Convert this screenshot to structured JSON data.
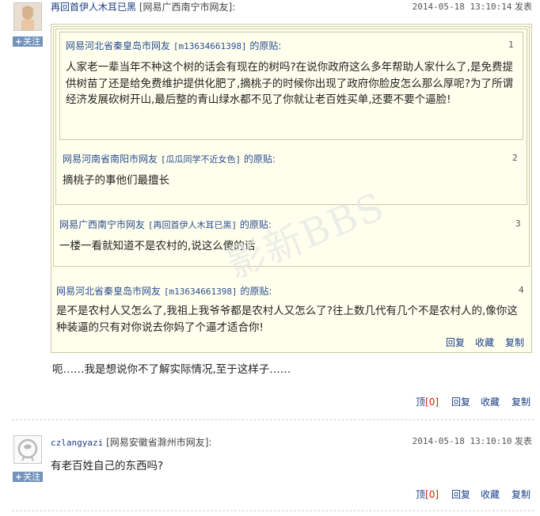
{
  "post1": {
    "author_name": "再回首伊人木耳已黑",
    "author_meta": "[网易广西南宁市网友]:",
    "timestamp": "2014-05-18 13:10:14",
    "post_label": "发表",
    "follow_label": "关注",
    "quotes": [
      {
        "num": "1",
        "header_prefix": "网易河北省秦皇岛市网友",
        "header_id": "[m13634661398]",
        "header_suffix": "的原贴:",
        "text": "人家老一辈当年不种这个树的话会有现在的树吗?在说你政府这么多年帮助人家什么了,是免费提供树苗了还是给免费维护提供化肥了,摘桃子的时候你出现了政府你脸皮怎么那么厚呢?为了所谓经济发展砍树开山,最后整的青山绿水都不见了你就让老百姓买单,还要不要个逼脸!"
      },
      {
        "num": "2",
        "header_prefix": "网易河南省南阳市网友",
        "header_id": "[瓜瓜同学不近女色]",
        "header_suffix": "的原贴:",
        "text": "摘桃子的事他们最擅长"
      },
      {
        "num": "3",
        "header_prefix": "网易广西南宁市网友",
        "header_id": "[再回首伊人木耳已黑]",
        "header_suffix": "的原贴:",
        "text": "一楼一看就知道不是农村的,说这么傻的话"
      },
      {
        "num": "4",
        "header_prefix": "网易河北省秦皇岛市网友",
        "header_id": "[m13634661398]",
        "header_suffix": "的原贴:",
        "text": "是不是农村人又怎么了,我祖上我爷爷都是农村人又怎么了?往上数几代有几个不是农村人的,像你这种装逼的只有对你说去你妈了个逼才适合你!"
      }
    ],
    "quote_actions": {
      "reply": "回复",
      "collect": "收藏",
      "copy": "复制"
    },
    "body": "呃……我是想说你不了解实际情况,至于这样子……",
    "actions": {
      "top": "顶",
      "top_count": "[0]",
      "reply": "回复",
      "collect": "收藏",
      "copy": "复制"
    }
  },
  "post2": {
    "author_name": "czlangyazi",
    "author_meta": "[网易安徽省滁州市网友]:",
    "timestamp": "2014-05-18 13:10:10",
    "post_label": "发表",
    "follow_label": "关注",
    "body": "有老百姓自己的东西吗?",
    "actions": {
      "top": "顶",
      "top_count": "[0]",
      "reply": "回复",
      "collect": "收藏",
      "copy": "复制"
    }
  },
  "watermark": "影新BBS",
  "colors": {
    "link": "#1a3d84",
    "quote_bg": "#ffffee",
    "quote_border": "#c9c9a8",
    "follow_bg": "#7393bb",
    "count_red": "#cc2200"
  }
}
